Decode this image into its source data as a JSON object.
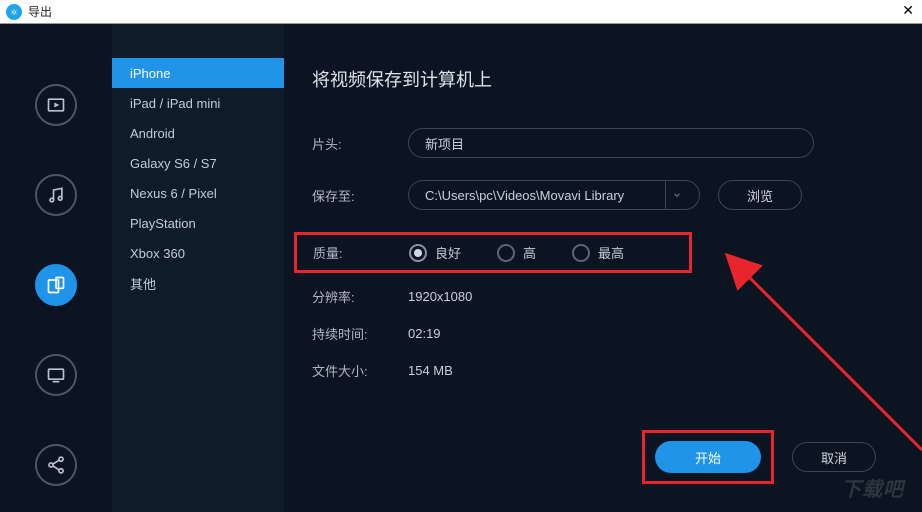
{
  "window": {
    "title": "导出"
  },
  "rail": {
    "items": [
      {
        "name": "video-icon"
      },
      {
        "name": "music-icon"
      },
      {
        "name": "device-icon",
        "active": true
      },
      {
        "name": "tv-icon"
      },
      {
        "name": "share-icon"
      }
    ]
  },
  "sidebar": {
    "items": [
      {
        "label": "iPhone",
        "selected": true
      },
      {
        "label": "iPad / iPad mini"
      },
      {
        "label": "Android"
      },
      {
        "label": "Galaxy S6 / S7"
      },
      {
        "label": "Nexus 6 / Pixel"
      },
      {
        "label": "PlayStation"
      },
      {
        "label": "Xbox 360"
      },
      {
        "label": "其他"
      }
    ]
  },
  "main": {
    "heading": "将视频保存到计算机上",
    "title_label": "片头:",
    "title_value": "新项目",
    "saveat_label": "保存至:",
    "saveat_value": "C:\\Users\\pc\\Videos\\Movavi Library",
    "browse_label": "浏览",
    "quality_label": "质量:",
    "quality_options": {
      "good": "良好",
      "high": "高",
      "best": "最高"
    },
    "resolution_label": "分辨率:",
    "resolution_value": "1920x1080",
    "duration_label": "持续时间:",
    "duration_value": "02:19",
    "filesize_label": "文件大小:",
    "filesize_value": "154 MB"
  },
  "actions": {
    "start": "开始",
    "cancel": "取消"
  },
  "watermark": "下载吧"
}
